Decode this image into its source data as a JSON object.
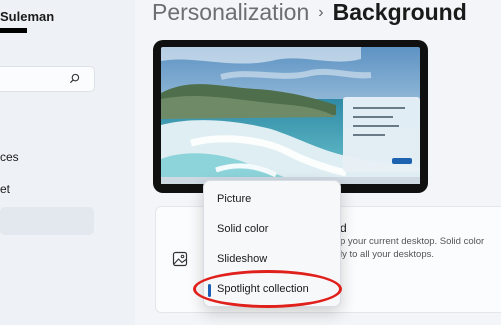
{
  "sidebar": {
    "user_name": "Suleman",
    "nav_items": [
      {
        "label": "ces"
      },
      {
        "label": "et"
      },
      {
        "label": ""
      }
    ]
  },
  "breadcrumb": {
    "parent": "Personalization",
    "separator": "›",
    "current": "Background"
  },
  "background_card": {
    "title": "d",
    "description": "p your current desktop. Solid color\nly to all your desktops."
  },
  "dropdown": {
    "options": [
      "Picture",
      "Solid color",
      "Slideshow",
      "Spotlight collection"
    ],
    "selected": "Spotlight collection"
  },
  "colors": {
    "accent": "#1a5fb4",
    "annotation": "#e0201b"
  },
  "icons": {
    "search": "search-icon",
    "picture": "picture-icon"
  }
}
